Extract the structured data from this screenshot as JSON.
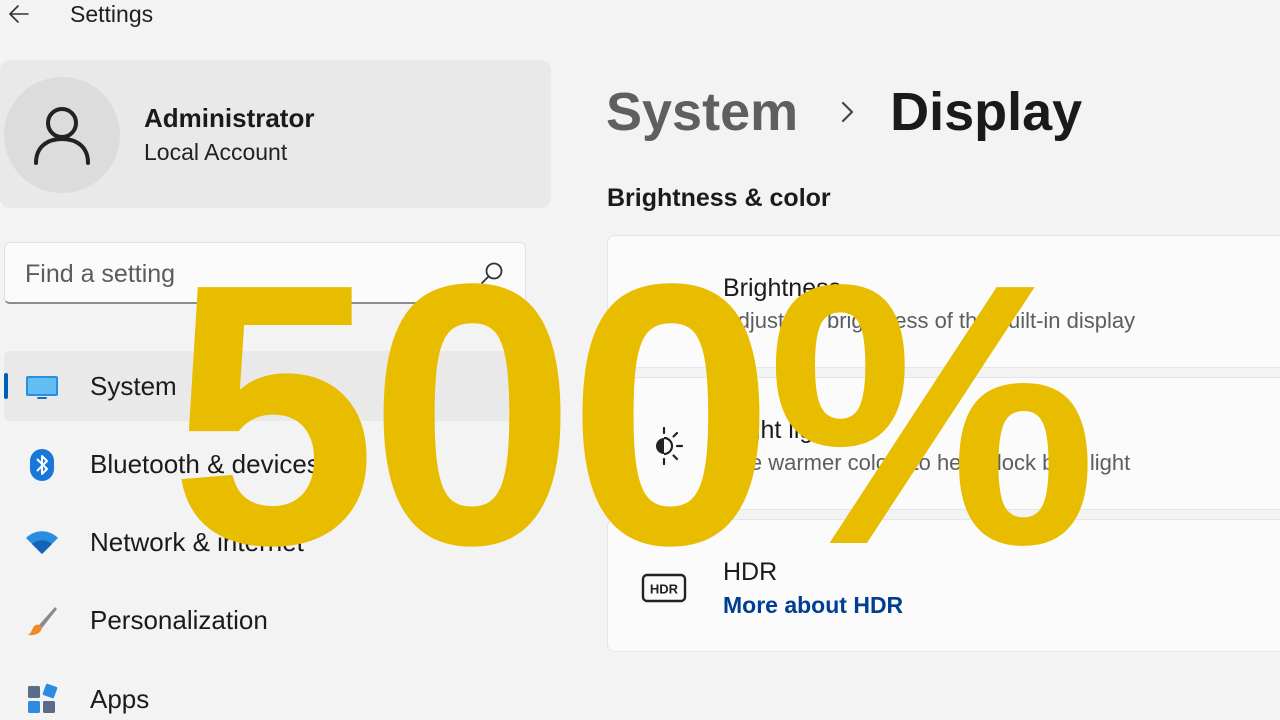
{
  "window": {
    "title": "Settings"
  },
  "profile": {
    "name": "Administrator",
    "account_type": "Local Account"
  },
  "search": {
    "placeholder": "Find a setting",
    "value": ""
  },
  "nav": {
    "items": [
      {
        "label": "System",
        "icon": "monitor-icon",
        "active": true
      },
      {
        "label": "Bluetooth & devices",
        "icon": "bluetooth-icon",
        "active": false
      },
      {
        "label": "Network & internet",
        "icon": "wifi-icon",
        "active": false
      },
      {
        "label": "Personalization",
        "icon": "paintbrush-icon",
        "active": false
      },
      {
        "label": "Apps",
        "icon": "apps-icon",
        "active": false
      }
    ]
  },
  "breadcrumb": {
    "parent": "System",
    "current": "Display"
  },
  "section": {
    "title": "Brightness & color"
  },
  "cards": [
    {
      "title": "Brightness",
      "subtitle": "Adjust the brightness of the built-in display",
      "icon": "brightness-icon"
    },
    {
      "title": "Night light",
      "subtitle": "Use warmer colors to help block blue light",
      "icon": "night-light-icon"
    },
    {
      "title": "HDR",
      "link": "More about HDR",
      "icon": "hdr-icon"
    }
  ],
  "overlay": {
    "text": "500%"
  },
  "colors": {
    "accent": "#005fb8",
    "overlay": "#e8bd00",
    "link": "#003e92",
    "background": "#f3f3f3"
  }
}
